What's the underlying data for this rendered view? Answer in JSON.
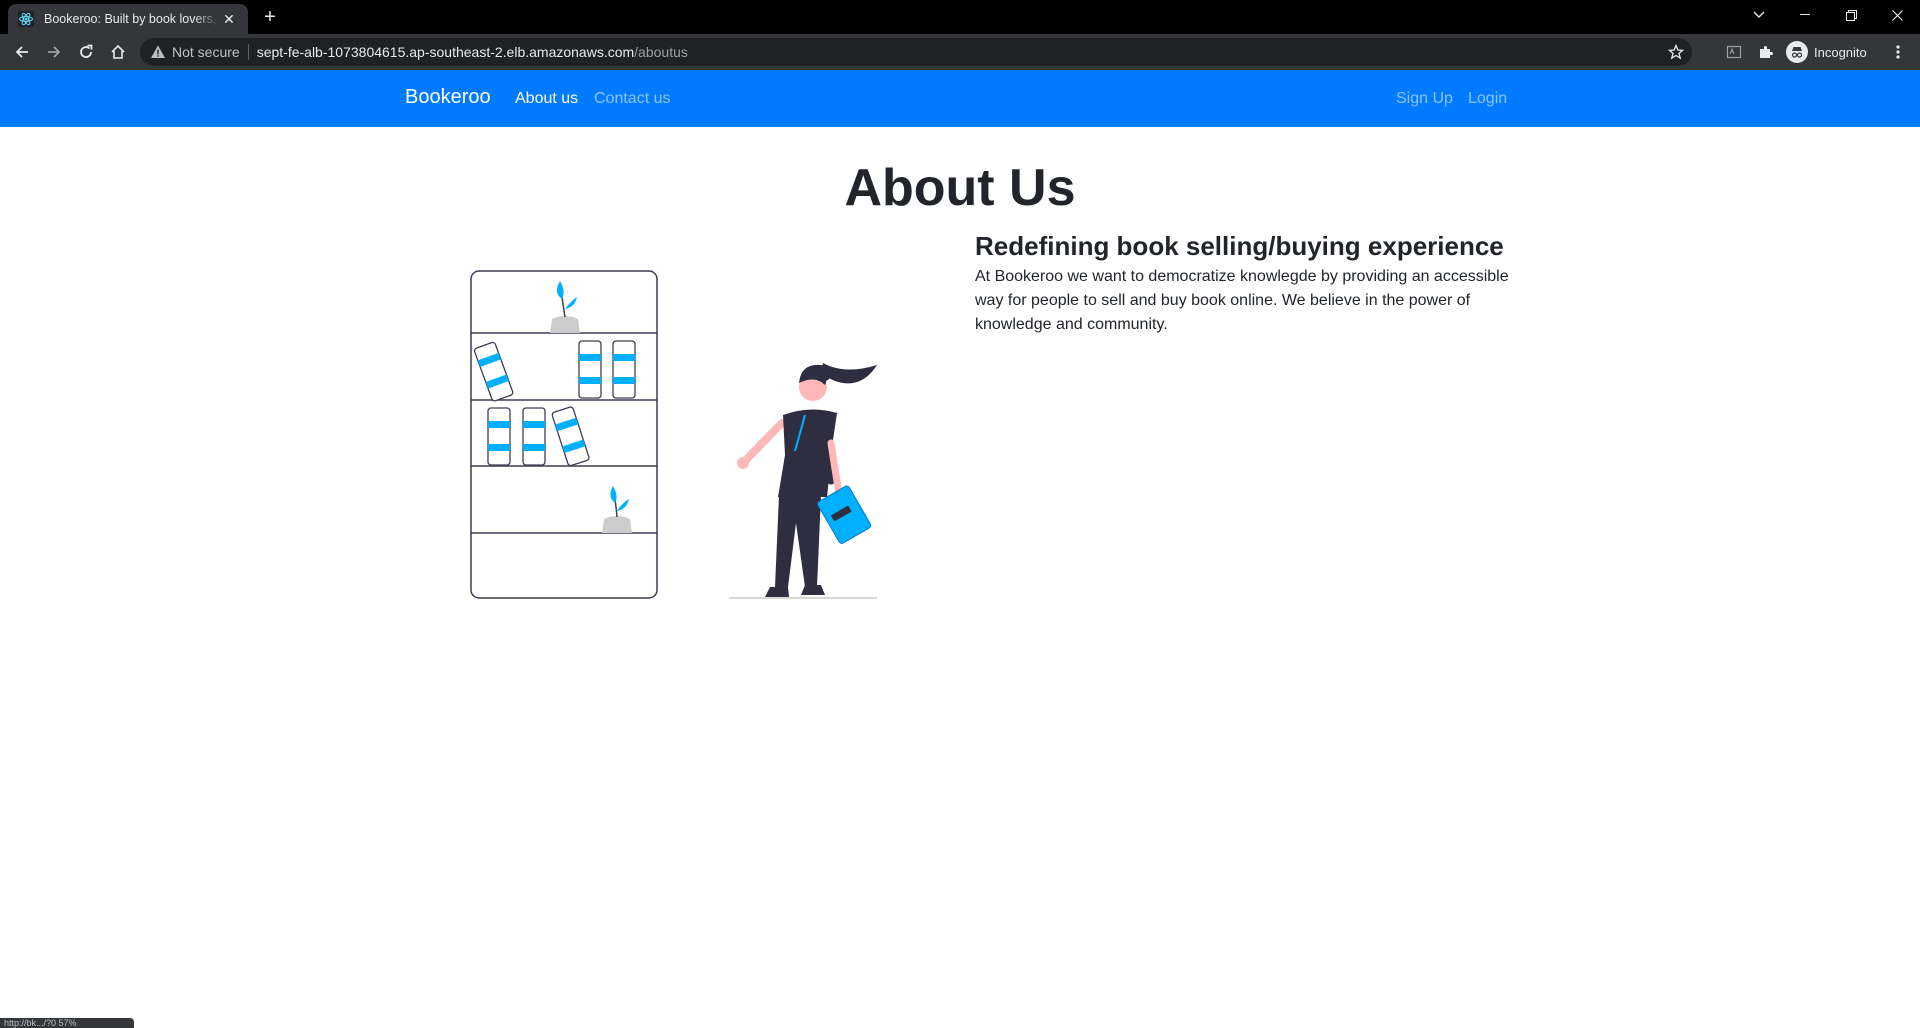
{
  "browser": {
    "tab_title": "Bookeroo: Built by book lovers, for book lovers",
    "address": {
      "security_label": "Not secure",
      "host": "sept-fe-alb-1073804615.ap-southeast-2.elb.amazonaws.com",
      "path": "/aboutus"
    },
    "profile_label": "Incognito",
    "status_text": "http://bk.../?0 57%"
  },
  "navbar": {
    "brand": "Bookeroo",
    "links": [
      {
        "label": "About us",
        "active": true
      },
      {
        "label": "Contact us",
        "active": false
      }
    ],
    "right_links": [
      {
        "label": "Sign Up"
      },
      {
        "label": "Login"
      }
    ],
    "color": "#007bff"
  },
  "main": {
    "title": "About Us",
    "subtitle": "Redefining book selling/buying experience",
    "body": "At Bookeroo we want to democratize knowlegde by providing an accessible way for people to sell and buy book online. We believe in the power of knowledge and community."
  },
  "illustration": {
    "icon": "bookshelf-reader-illustration",
    "accent_color": "#00b0ff",
    "line_color": "#3f3d56"
  }
}
